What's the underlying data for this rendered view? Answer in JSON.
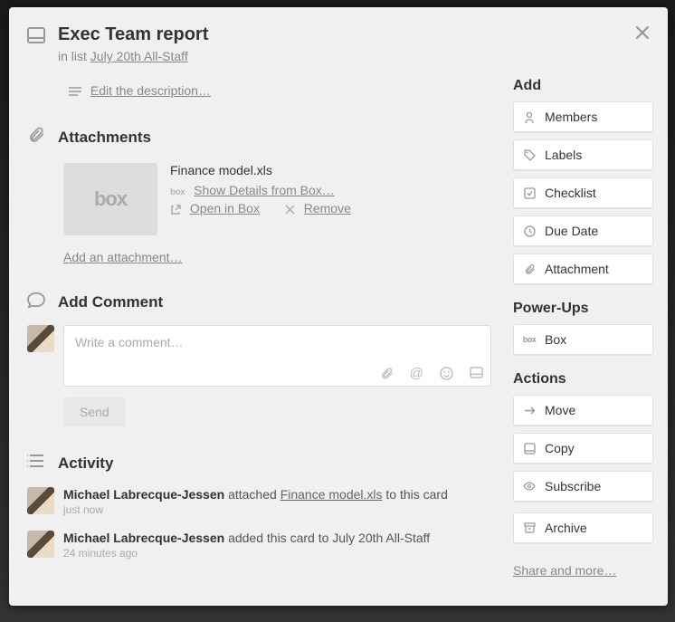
{
  "card": {
    "title": "Exec Team report",
    "in_list_prefix": "in list ",
    "in_list_name": "July 20th All-Staff"
  },
  "description": {
    "edit_label": "Edit the description…"
  },
  "attachments": {
    "heading": "Attachments",
    "items": [
      {
        "name": "Finance model.xls",
        "provider_logo": "box",
        "show_details": "Show Details from Box…",
        "open_label": "Open in Box",
        "remove_label": "Remove"
      }
    ],
    "add_label": "Add an attachment…"
  },
  "comment": {
    "heading": "Add Comment",
    "placeholder": "Write a comment…",
    "send_label": "Send"
  },
  "activity": {
    "heading": "Activity",
    "entries": [
      {
        "actor": "Michael Labrecque-Jessen",
        "verb": " attached ",
        "object": "Finance model.xls",
        "suffix": " to this card",
        "time": "just now"
      },
      {
        "actor": "Michael Labrecque-Jessen",
        "verb": " added this card to July 20th All-Staff",
        "object": "",
        "suffix": "",
        "time": "24 minutes ago"
      }
    ]
  },
  "sidebar": {
    "add_heading": "Add",
    "add_items": [
      {
        "icon": "user",
        "label": "Members"
      },
      {
        "icon": "tag",
        "label": "Labels"
      },
      {
        "icon": "check",
        "label": "Checklist"
      },
      {
        "icon": "clock",
        "label": "Due Date"
      },
      {
        "icon": "clip",
        "label": "Attachment"
      }
    ],
    "powerups_heading": "Power-Ups",
    "powerup_items": [
      {
        "icon": "box",
        "label": "Box"
      }
    ],
    "actions_heading": "Actions",
    "action_items": [
      {
        "icon": "arrow",
        "label": "Move"
      },
      {
        "icon": "copy",
        "label": "Copy"
      },
      {
        "icon": "eye",
        "label": "Subscribe"
      },
      {
        "icon": "archive",
        "label": "Archive"
      }
    ],
    "share_label": "Share and more…"
  }
}
